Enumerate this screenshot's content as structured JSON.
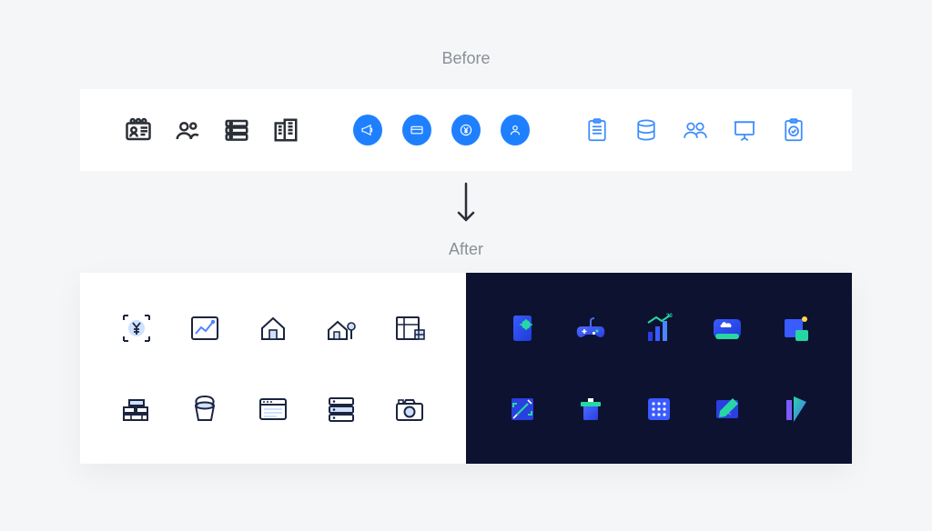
{
  "labels": {
    "before": "Before",
    "after": "After"
  },
  "colors": {
    "bg": "#f5f6f7",
    "card": "#ffffff",
    "dark_panel": "#0c1230",
    "blue": "#1e80ff",
    "blue_light": "#3b8cff",
    "navy": "#1b2540",
    "accent_green": "#27d7a2",
    "accent_purple": "#7b5cff",
    "muted_text": "#8a8f98"
  },
  "before_icons": {
    "group_dark_outline": [
      "id-card-icon",
      "users-icon",
      "server-list-icon",
      "building-icon"
    ],
    "group_solid_blue": [
      "megaphone-icon",
      "card-icon",
      "yen-coin-icon",
      "user-shield-icon"
    ],
    "group_thin_blue": [
      "clipboard-icon",
      "database-icon",
      "people-icon",
      "presentation-icon",
      "clipboard-check-icon"
    ]
  },
  "after_light_icons": [
    "yen-target-icon",
    "trend-chart-icon",
    "home-icon",
    "house-tree-icon",
    "blueprint-icon",
    "bricks-icon",
    "bucket-icon",
    "window-app-icon",
    "server-rows-icon",
    "camera-icon"
  ],
  "after_dark_icons": [
    "device-gear-icon",
    "game-controller-icon",
    "bar-growth-icon",
    "cloud-drive-icon",
    "tile-dot-icon",
    "resize-frame-icon",
    "podium-icon",
    "grid-dots-icon",
    "pencil-note-icon",
    "layers-angle-icon"
  ]
}
